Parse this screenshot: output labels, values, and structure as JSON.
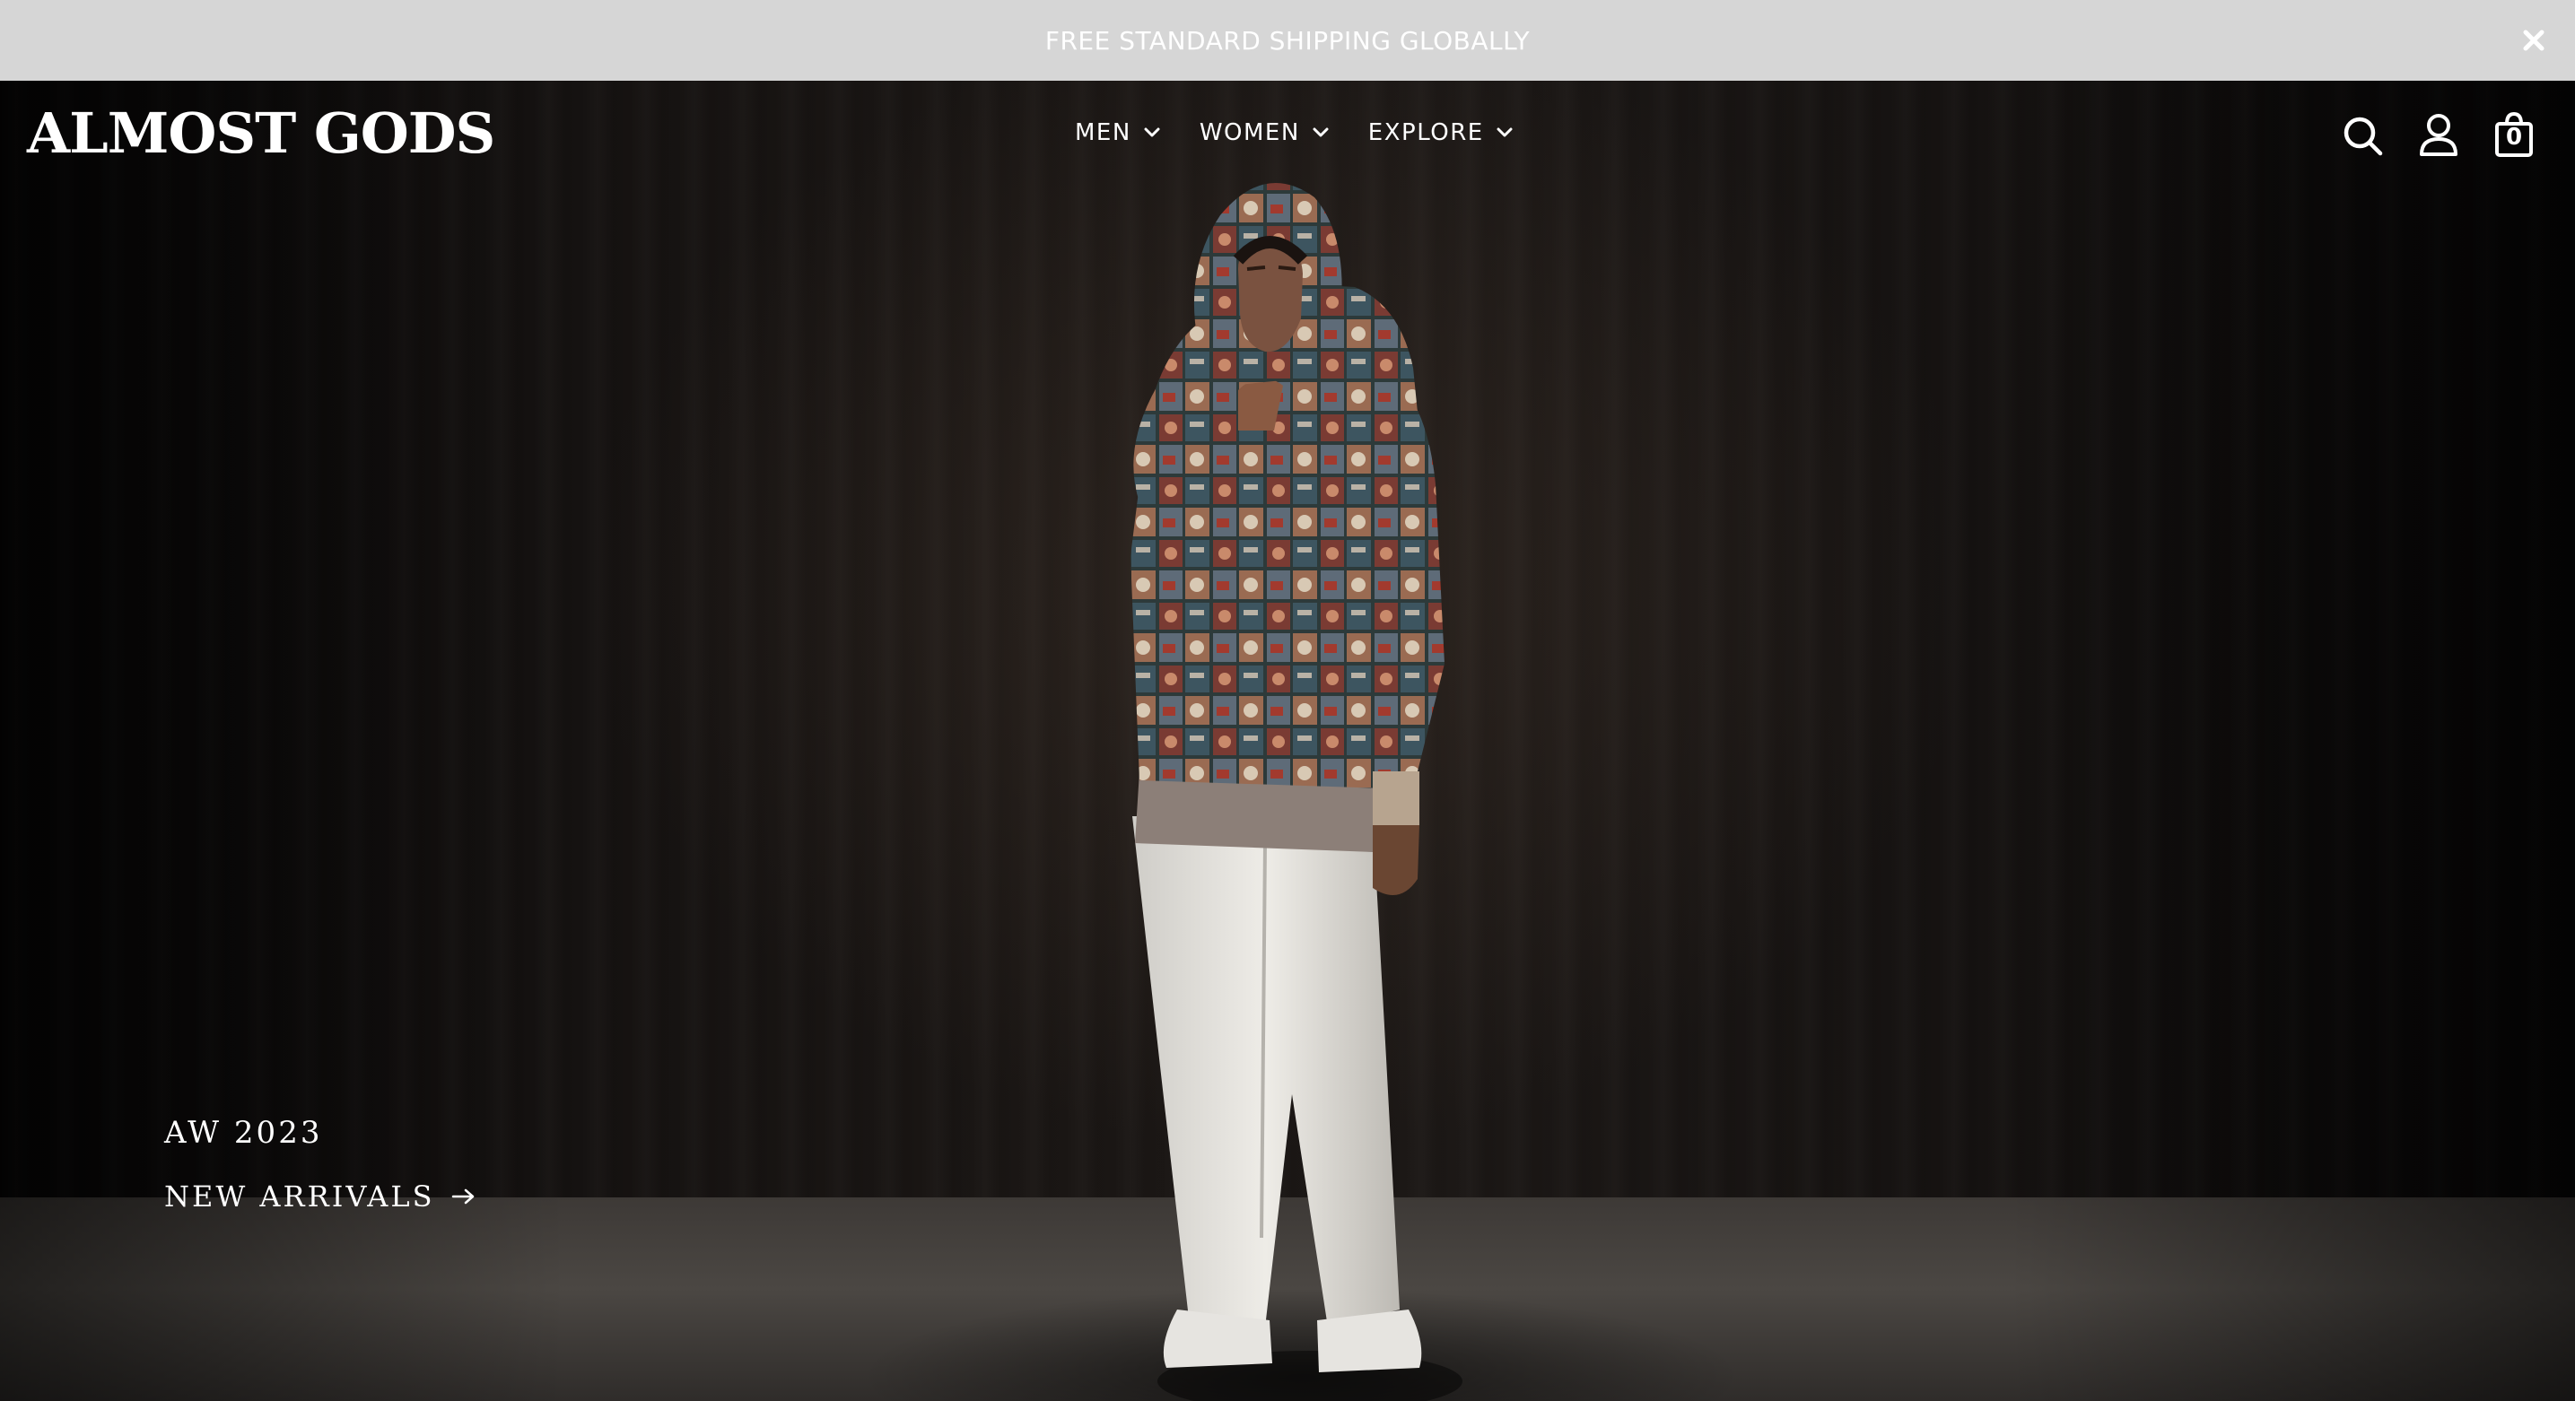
{
  "announcement": {
    "text": "FREE STANDARD SHIPPING GLOBALLY",
    "close_icon": "close-icon"
  },
  "header": {
    "logo": "ALMOST GODS",
    "nav": [
      {
        "label": "MEN",
        "icon": "chevron-down-icon"
      },
      {
        "label": "WOMEN",
        "icon": "chevron-down-icon"
      },
      {
        "label": "EXPLORE",
        "icon": "chevron-down-icon"
      }
    ],
    "icons": [
      "search-icon",
      "account-icon",
      "bag-icon"
    ],
    "cart_count": "0"
  },
  "hero": {
    "season": "AW 2023",
    "cta_label": "NEW ARRIVALS",
    "cta_icon": "arrow-right-icon"
  },
  "colors": {
    "announcement_bg": "#d6d6d6",
    "text": "#ffffff",
    "hero_bg": "#141110",
    "floor": "#4b4743"
  }
}
